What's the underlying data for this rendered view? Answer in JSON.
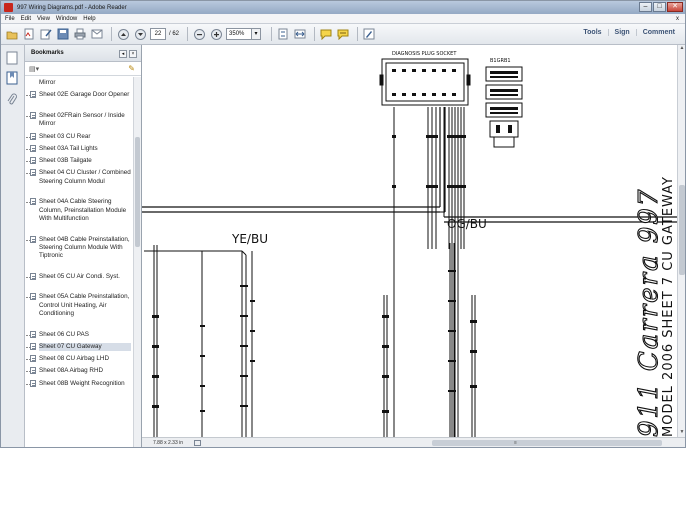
{
  "window": {
    "title": "997 Wiring Diagrams.pdf - Adobe Reader",
    "controls": {
      "minimize": "–",
      "maximize": "□",
      "close": "✕"
    }
  },
  "menu": {
    "items": [
      "File",
      "Edit",
      "View",
      "Window",
      "Help"
    ],
    "close_doc": "x"
  },
  "toolbar": {
    "page_current": "22",
    "page_total": "/ 62",
    "zoom": "350%",
    "zoom_dropdown": "▾",
    "links": {
      "tools": "Tools",
      "sign": "Sign",
      "comment": "Comment"
    },
    "icons": [
      "open-folder-icon",
      "create-pdf-icon",
      "edit-icon",
      "save-icon",
      "print-icon",
      "email-icon",
      "page-up-icon",
      "page-down-icon",
      "zoom-out-icon",
      "zoom-in-icon",
      "fit-page-icon",
      "fit-width-icon",
      "comment-icon",
      "highlight-icon",
      "sign-icon"
    ]
  },
  "bookmarks": {
    "title": "Bookmarks",
    "items": [
      {
        "label": "Mirror",
        "page": false
      },
      {
        "label": "Sheet 02E Garage Door Opener",
        "page": true
      },
      {
        "label": "Sheet 02FRain Sensor / Inside Mirror",
        "page": true
      },
      {
        "label": "Sheet 03 CU Rear",
        "page": true
      },
      {
        "label": "Sheet 03A Tail Lights",
        "page": true
      },
      {
        "label": "Sheet 03B Tailgate",
        "page": true
      },
      {
        "label": "Sheet 04 CU Cluster / Combined Steering Column Modul",
        "page": true
      },
      {
        "label": "Sheet 04A Cable Steering Column, Preinstallation Module With Multifunction",
        "page": true
      },
      {
        "label": "Sheet 04B Cable Preinstallation, Steering Column Module With Tiptronic",
        "page": true
      },
      {
        "label": "Sheet 05 CU Air Condi. Syst.",
        "page": true
      },
      {
        "label": "Sheet 05A Cable Preinstallation, Control Unit Heating, Air Conditioning",
        "page": true
      },
      {
        "label": "Sheet 06 CU PAS",
        "page": true
      },
      {
        "label": "Sheet 07 CU Gateway",
        "page": true,
        "selected": true
      },
      {
        "label": "Sheet 08 CU Airbag LHD",
        "page": true
      },
      {
        "label": "Sheet 08A Airbag RHD",
        "page": true
      },
      {
        "label": "Sheet 08B Weight Recognition",
        "page": true
      }
    ]
  },
  "diagram": {
    "socket_label": "DIAGNOSIS PLUG SOCKET",
    "connector_label": "B1GRB1",
    "wire_label_1": "YE/BU",
    "wire_label_2": "OG/BU",
    "title_model": "911 Carrera 997",
    "title_sheet": "MODEL 2006 SHEET 7 CU GATEWAY"
  },
  "status": {
    "page_size": "7.88 x 2.33 in"
  }
}
